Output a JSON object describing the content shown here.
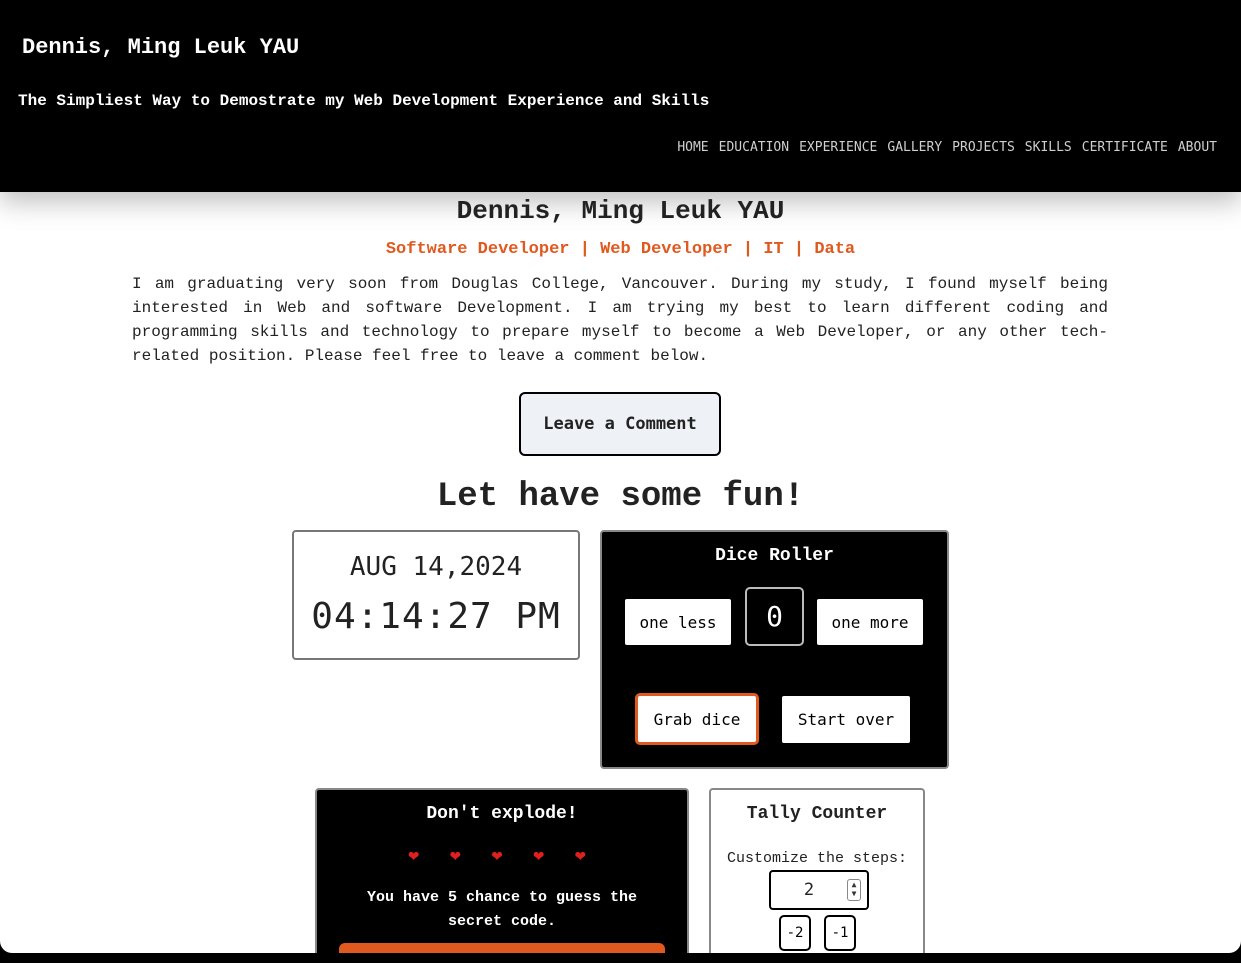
{
  "header": {
    "title": "Dennis, Ming Leuk YAU",
    "tagline": "The Simpliest Way to Demostrate my Web Development Experience and Skills",
    "nav": [
      "HOME",
      "EDUCATION",
      "EXPERIENCE",
      "GALLERY",
      "PROJECTS",
      "SKILLS",
      "CERTIFICATE",
      "ABOUT"
    ]
  },
  "intro": {
    "name": "Dennis, Ming Leuk YAU",
    "roles": "Software Developer | Web Developer | IT | Data",
    "bio": "I am graduating very soon from Douglas College, Vancouver. During my study, I found myself being interested in Web and software Development. I am trying my best to learn different coding and programming skills and technology to prepare myself to become a Web Developer, or any other tech-related position. Please feel free to leave a comment below.",
    "comment_button": "Leave a Comment"
  },
  "fun": {
    "title": "Let have some fun!",
    "clock": {
      "date": "AUG 14,2024",
      "time": "04:14:27 PM"
    },
    "dice": {
      "title": "Dice Roller",
      "less_label": "one less",
      "value": "0",
      "more_label": "one more",
      "grab_label": "Grab dice",
      "reset_label": "Start over"
    },
    "explode": {
      "title": "Don't explode!",
      "hearts": "❤ ❤ ❤ ❤ ❤",
      "text": "You have 5 chance to guess the secret code."
    },
    "tally": {
      "title": "Tally Counter",
      "steps_label": "Customize the steps:",
      "step_value": "2",
      "minus2_label": "-2",
      "minus1_label": "-1"
    }
  },
  "colors": {
    "accent": "#e0591f",
    "header_bg": "#000000"
  }
}
